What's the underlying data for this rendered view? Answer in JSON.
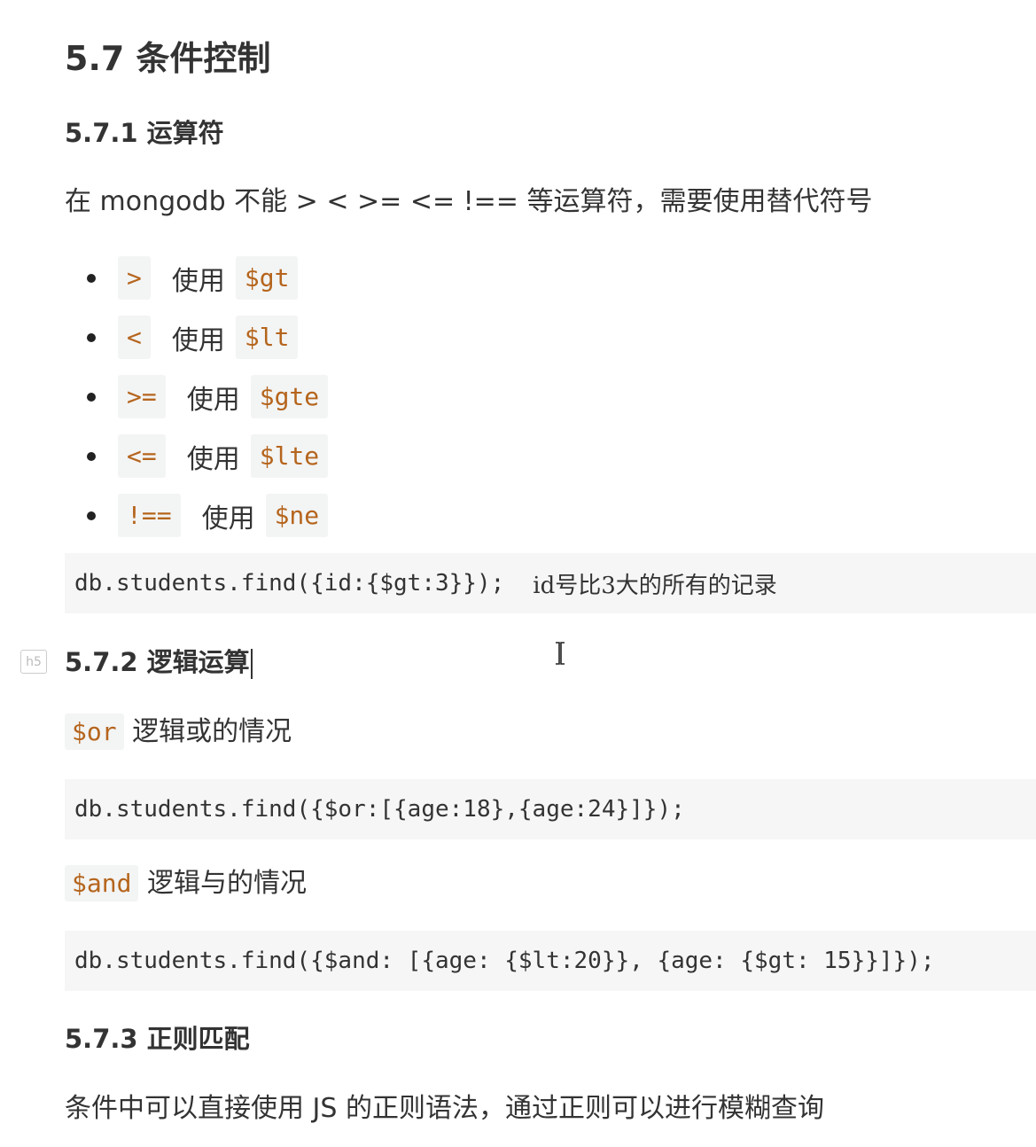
{
  "section": {
    "title": "5.7 条件控制"
  },
  "operators": {
    "heading": "5.7.1 运算符",
    "intro": "在 mongodb 不能 > < >=  <= !== 等运算符，需要使用替代符号",
    "items": [
      {
        "symbol": ">",
        "use": "使用",
        "replacement": "$gt"
      },
      {
        "symbol": "<",
        "use": "使用",
        "replacement": "$lt"
      },
      {
        "symbol": ">=",
        "use": "使用",
        "replacement": "$gte"
      },
      {
        "symbol": "<=",
        "use": "使用",
        "replacement": "$lte"
      },
      {
        "symbol": "!==",
        "use": "使用",
        "replacement": "$ne"
      }
    ],
    "example_code": "db.students.find({id:{$gt:3}});",
    "example_comment": "id号比3大的所有的记录"
  },
  "logic": {
    "heading": "5.7.2 逻辑运算",
    "badge": "h5",
    "or_keyword": "$or",
    "or_desc": "逻辑或的情况",
    "or_code": "db.students.find({$or:[{age:18},{age:24}]});",
    "and_keyword": "$and",
    "and_desc": "逻辑与的情况",
    "and_code": "db.students.find({$and: [{age: {$lt:20}}, {age: {$gt: 15}}]});"
  },
  "regex": {
    "heading": "5.7.3 正则匹配",
    "intro": "条件中可以直接使用 JS 的正则语法，通过正则可以进行模糊查询"
  }
}
